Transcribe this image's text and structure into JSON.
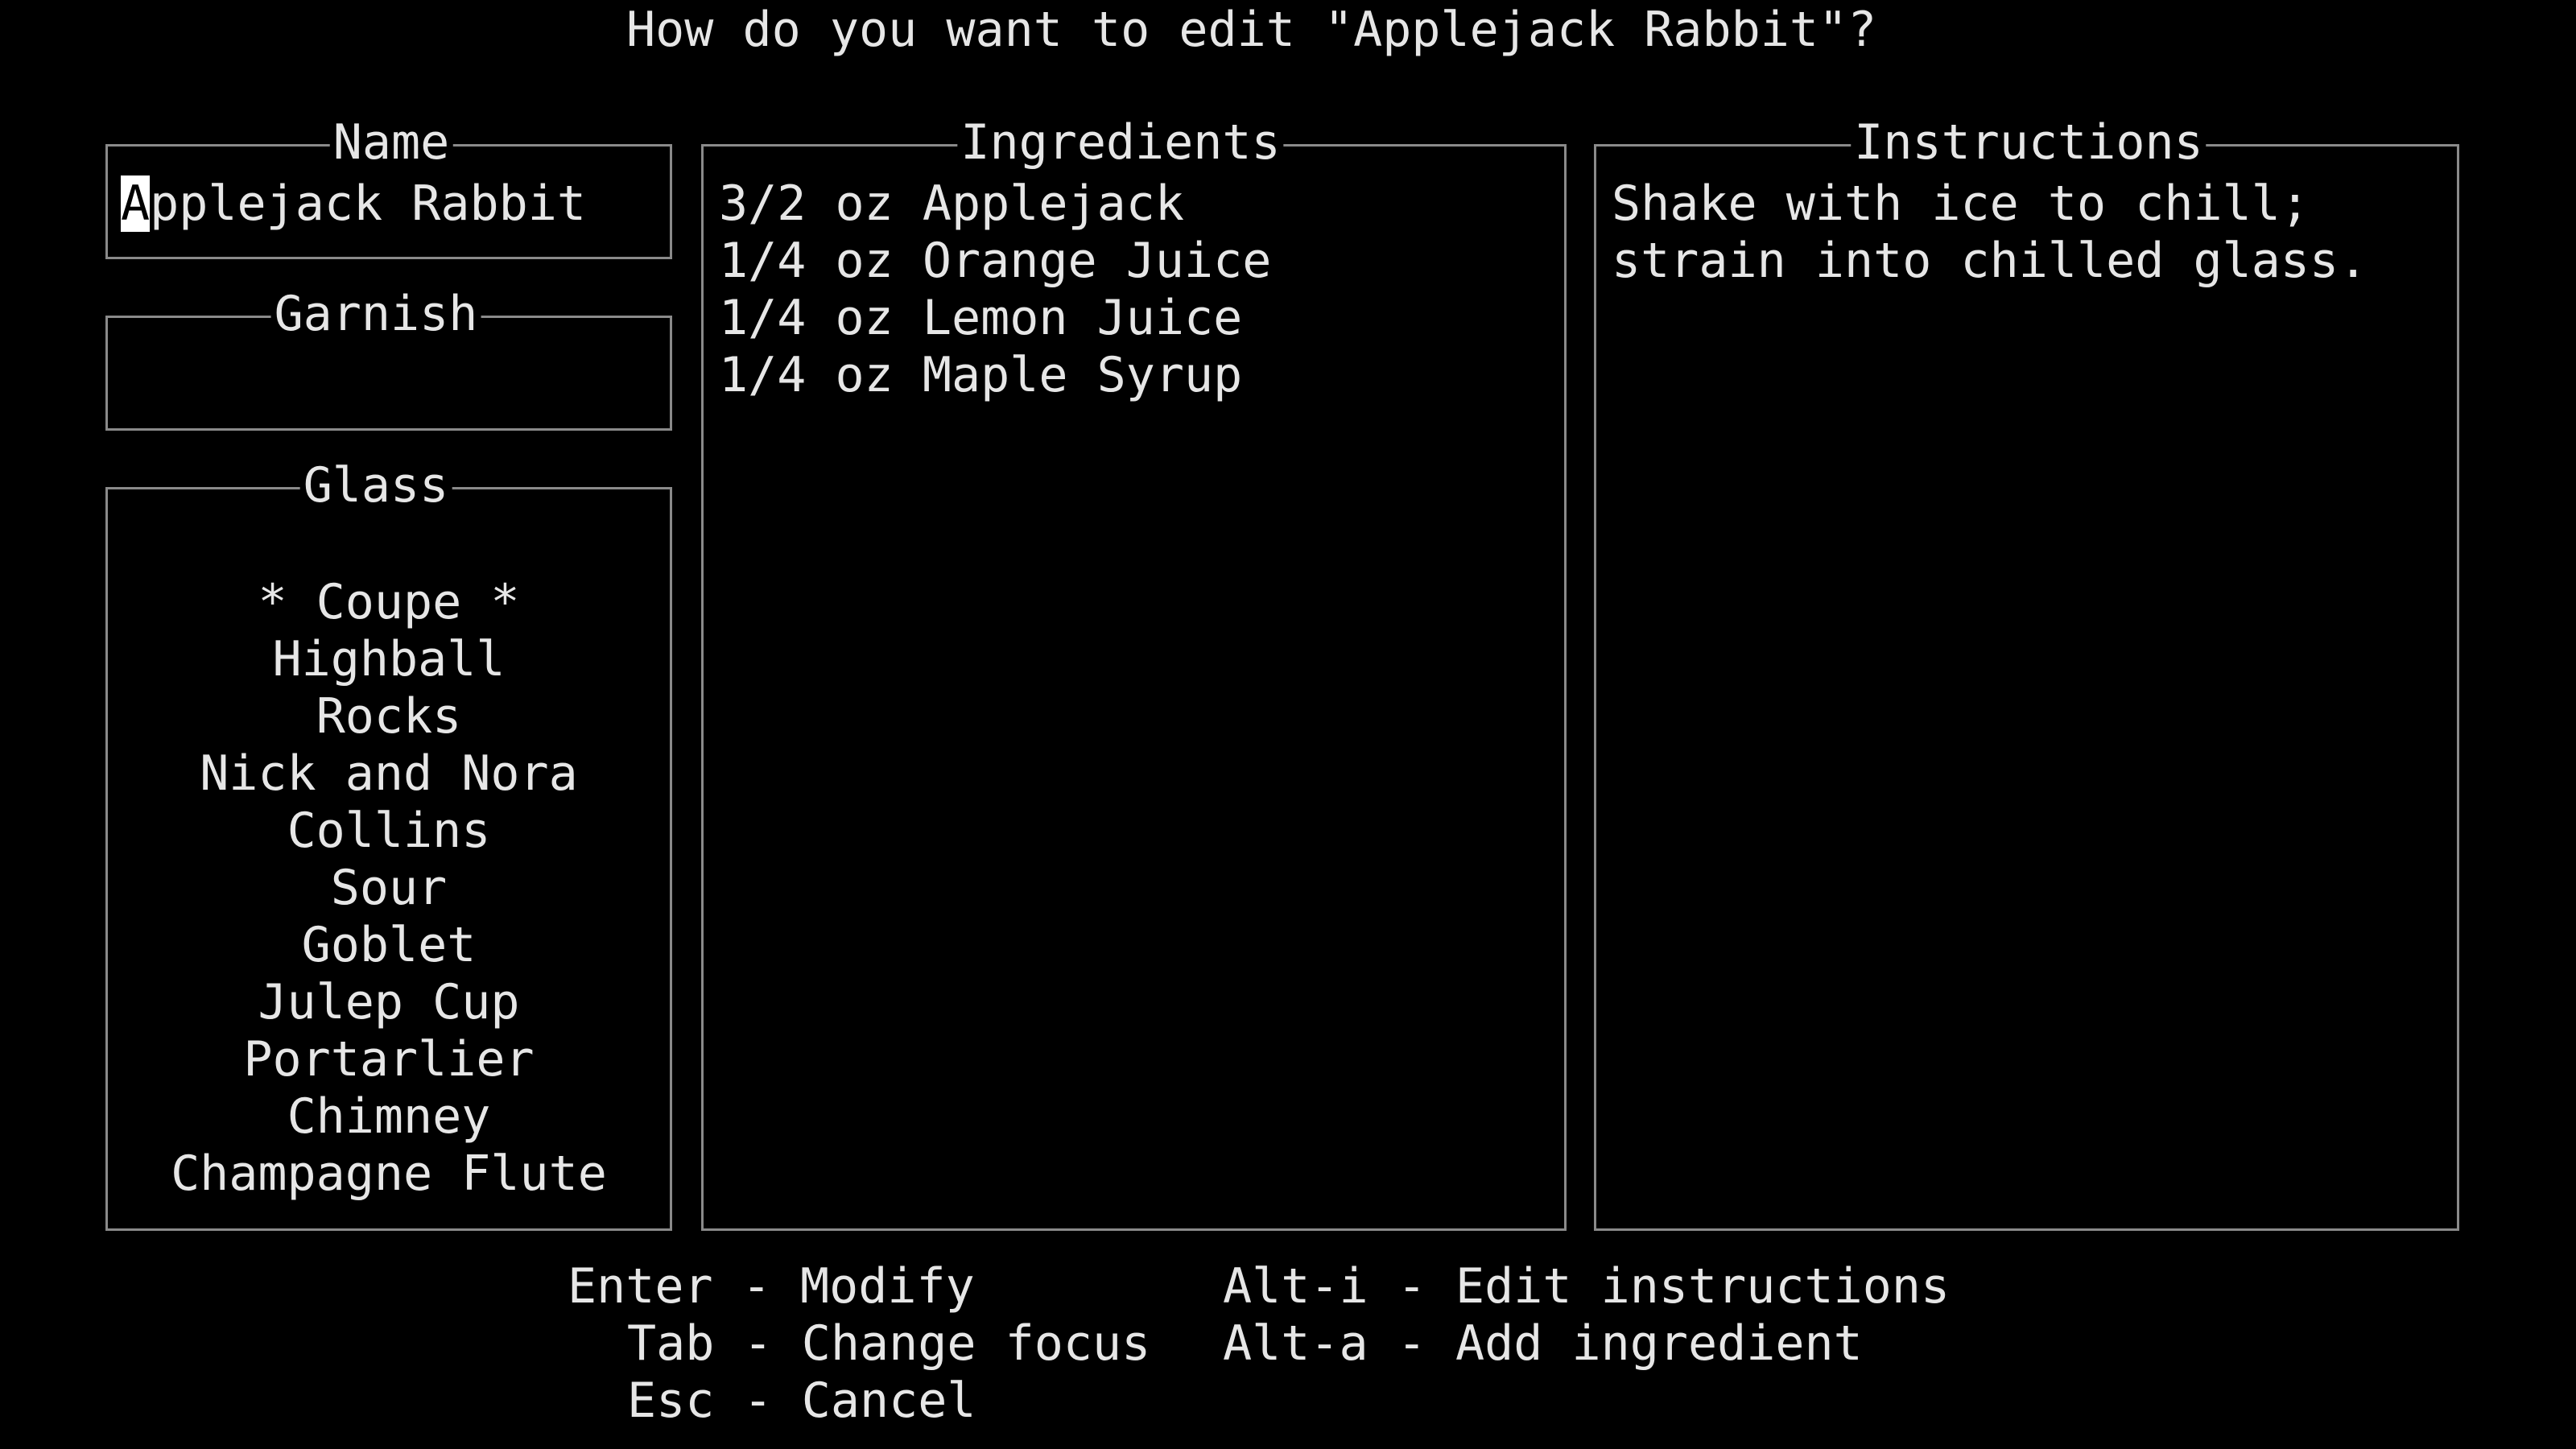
{
  "dialog": {
    "title": "How do you want to edit \"Applejack Rabbit\"?"
  },
  "name_field": {
    "label": "Name",
    "value_first": "A",
    "value_rest": "pplejack Rabbit"
  },
  "garnish_field": {
    "label": "Garnish",
    "value": ""
  },
  "glass": {
    "label": "Glass",
    "options": [
      "* Coupe *",
      "Highball",
      "Rocks",
      "Nick and Nora",
      "Collins",
      "Sour",
      "Goblet",
      "Julep Cup",
      "Portarlier",
      "Chimney",
      "Champagne Flute"
    ]
  },
  "ingredients": {
    "label": "Ingredients",
    "items": [
      "3/2 oz Applejack",
      "1/4 oz Orange Juice",
      "1/4 oz Lemon Juice",
      "1/4 oz Maple Syrup"
    ]
  },
  "instructions": {
    "label": "Instructions",
    "lines": [
      "Shake with ice to chill;",
      "strain into chilled glass."
    ]
  },
  "help": {
    "enter": "Enter - Modify",
    "tab": "Tab - Change focus",
    "esc": "Esc - Cancel",
    "alt_i": "Alt-i - Edit instructions",
    "alt_a": "Alt-a - Add ingredient"
  },
  "colors": {
    "background": "#000000",
    "text": "#e6e6e6",
    "border": "#8a8a8a",
    "cursor": "#ffffff"
  }
}
